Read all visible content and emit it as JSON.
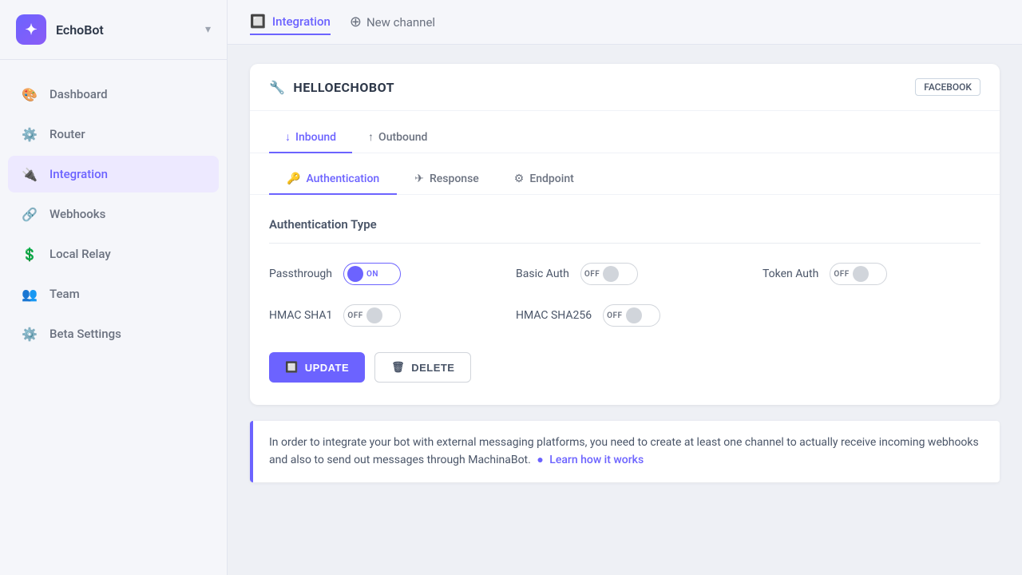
{
  "app": {
    "name": "EchoBot",
    "chevron": "▾"
  },
  "sidebar": {
    "items": [
      {
        "id": "dashboard",
        "label": "Dashboard",
        "icon": "🎨",
        "active": false
      },
      {
        "id": "router",
        "label": "Router",
        "icon": "⚙️",
        "active": false
      },
      {
        "id": "integration",
        "label": "Integration",
        "icon": "🔌",
        "active": true
      },
      {
        "id": "webhooks",
        "label": "Webhooks",
        "icon": "🔗",
        "active": false
      },
      {
        "id": "local-relay",
        "label": "Local Relay",
        "icon": "💲",
        "active": false
      },
      {
        "id": "team",
        "label": "Team",
        "icon": "👥",
        "active": false
      },
      {
        "id": "beta-settings",
        "label": "Beta Settings",
        "icon": "⚙️",
        "active": false
      }
    ]
  },
  "topbar": {
    "integration_label": "Integration",
    "new_channel_label": "New channel"
  },
  "channel": {
    "wrench_icon": "🔧",
    "title": "HELLOECHOBOT",
    "badge": "FACEBOOK",
    "tabs": {
      "direction": [
        {
          "id": "inbound",
          "label": "Inbound",
          "icon": "↓",
          "active": true
        },
        {
          "id": "outbound",
          "label": "Outbound",
          "icon": "↑",
          "active": false
        }
      ],
      "sub": [
        {
          "id": "authentication",
          "label": "Authentication",
          "icon": "🔑",
          "active": true
        },
        {
          "id": "response",
          "label": "Response",
          "icon": "✈",
          "active": false
        },
        {
          "id": "endpoint",
          "label": "Endpoint",
          "icon": "⚙",
          "active": false
        }
      ]
    }
  },
  "auth": {
    "section_title": "Authentication Type",
    "items": [
      {
        "id": "passthrough",
        "label": "Passthrough",
        "state": "on",
        "state_label": "ON"
      },
      {
        "id": "basic-auth",
        "label": "Basic Auth",
        "state": "off",
        "state_label": "OFF"
      },
      {
        "id": "token-auth",
        "label": "Token Auth",
        "state": "off",
        "state_label": "OFF"
      },
      {
        "id": "hmac-sha1",
        "label": "HMAC SHA1",
        "state": "off",
        "state_label": "OFF"
      },
      {
        "id": "hmac-sha256",
        "label": "HMAC SHA256",
        "state": "off",
        "state_label": "OFF"
      }
    ],
    "buttons": {
      "update": "UPDATE",
      "delete": "DELETE"
    }
  },
  "info_banner": {
    "text": "In order to integrate your bot with external messaging platforms, you need to create at least one channel to actually receive incoming webhooks and also to send out messages through MachinaBot.",
    "link_label": "Learn how it works"
  }
}
